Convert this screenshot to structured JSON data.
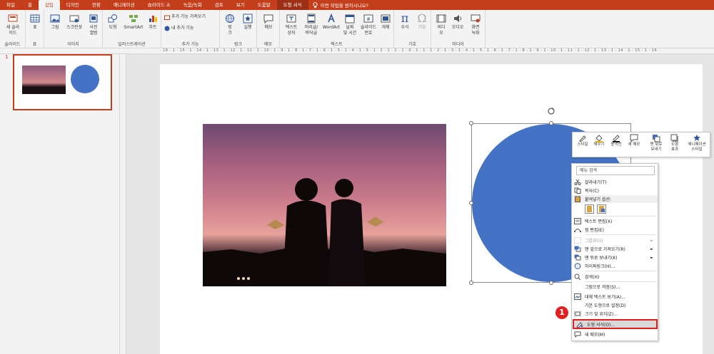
{
  "tabs": [
    "파일",
    "홈",
    "삽입",
    "디자인",
    "전환",
    "애니메이션",
    "슬라이드 쇼",
    "녹음/녹화",
    "검토",
    "보기",
    "도움말",
    "도형 서식"
  ],
  "tell_me": "어떤 작업을 원하시나요?",
  "ribbon": {
    "new_slide": "새 슬라\n이드",
    "table": "표",
    "picture": "그림",
    "screenshot": "스크린샷",
    "album": "사진\n앨범",
    "shapes": "도형",
    "smartart": "SmartArt",
    "chart": "차트",
    "get_addins": "추가 기능 가져오기",
    "my_addins": "내 추가 기능",
    "link": "링\n크",
    "action": "실행",
    "comment": "메모",
    "textbox": "텍스트\n상자",
    "header_footer": "머리글/\n바닥글",
    "wordart": "WordArt",
    "date_time": "날짜\n및 시간",
    "slide_number": "슬라이드\n번호",
    "object": "개체",
    "equation": "수식",
    "symbol": "기호",
    "video": "비디\n오",
    "audio": "오디오",
    "screen_recording": "화면\n녹화",
    "groups": [
      "슬라이드",
      "표",
      "이미지",
      "일러스트레이션",
      "추가 기능",
      "링크",
      "메모",
      "텍스트",
      "기호",
      "미디어"
    ]
  },
  "ruler_text": "· 16 · 1 · 15 · 1 · 14 · 1 · 13 · 1 · 12 · 1 · 11 · 1 · 10 · 1 · 9 · 1 · 8 · 1 · 7 · 1 · 6 · 1 · 5 · 1 · 4 · 1 · 3 · 1 · 2 · 1 · 1 · 1 · 0 · 1 · 1 · 1 · 2 · 1 · 3 · 1 · 4 · 1 · 5 · 1 · 6 · 1 · 7 · 1 · 8 · 1 · 9 · 1 · 10 · 1 · 11 · 1 · 12 · 1 · 13 · 1 · 14 · 1 · 15 · 1 · 16 ·",
  "slide_number": "1",
  "colors": {
    "accent": "#c43e1c",
    "circle": "#4472c4",
    "highlight": "#e02020"
  },
  "mini_toolbar": [
    "스타일",
    "채우기",
    "윤곽선",
    "새 메모",
    "맨 뒤로\n보내기",
    "도형\n효과",
    "애니메이션\n스타일"
  ],
  "context_menu": {
    "search_placeholder": "메뉴 검색",
    "items": [
      "잘라내기(T)",
      "복사(C)",
      "붙여넣기 옵션:",
      "텍스트 편집(X)",
      "점 편집(E)",
      "그룹화(G)",
      "맨 앞으로 가져오기(R)",
      "맨 뒤로 보내기(K)",
      "하이퍼링크(H)...",
      "검색(H)",
      "그림으로 저장(S)...",
      "대체 텍스트 보기(A)...",
      "기본 도형으로 설정(D)",
      "크기 및 위치(Z)...",
      "도형 서식(O)...",
      "새 메모(M)"
    ]
  },
  "step_badge": "1"
}
